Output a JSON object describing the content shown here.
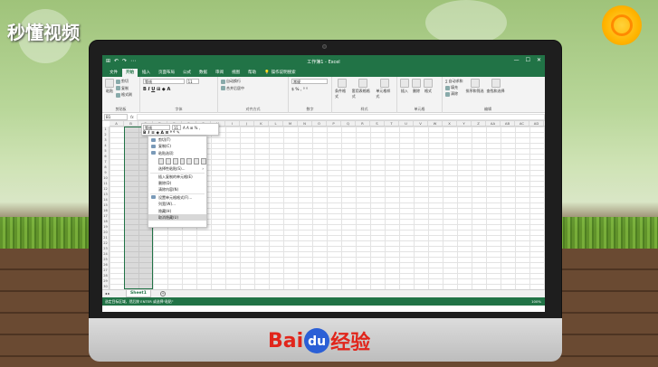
{
  "watermark": {
    "top_left": "秒懂视频",
    "bottom_brand_bai": "Bai",
    "bottom_brand_du": "du",
    "bottom_brand_jy": "经验"
  },
  "excel": {
    "title": "工作簿1 - Excel",
    "qat": [
      "⊞",
      "↶",
      "↷",
      "⋯"
    ],
    "window_controls": [
      "—",
      "☐",
      "✕"
    ],
    "tabs": [
      "文件",
      "开始",
      "插入",
      "页面布局",
      "公式",
      "数据",
      "审阅",
      "视图",
      "帮助"
    ],
    "active_tab": "开始",
    "tell_me": "操作说明搜索",
    "ribbon": {
      "clipboard": {
        "label": "剪贴板",
        "paste": "粘贴",
        "cut": "剪切",
        "copy": "复制",
        "format": "格式刷"
      },
      "font": {
        "label": "字体",
        "name": "等线",
        "size": "11"
      },
      "alignment": {
        "label": "对齐方式",
        "wrap": "自动换行",
        "merge": "合并后居中"
      },
      "number": {
        "label": "数字",
        "format": "常规"
      },
      "styles": {
        "label": "样式",
        "cond": "条件格式",
        "table": "套用表格格式",
        "cell": "单元格样式"
      },
      "cells": {
        "label": "单元格",
        "insert": "插入",
        "delete": "删除",
        "format": "格式"
      },
      "editing": {
        "label": "编辑",
        "autosum": "自动求和",
        "fill": "填充",
        "clear": "清除",
        "sort": "排序和筛选",
        "find": "查找和选择"
      }
    },
    "name_box": "B1",
    "formula_fx": "fx",
    "columns": [
      "A",
      "B",
      "C",
      "D",
      "E",
      "F",
      "G",
      "H",
      "I",
      "J",
      "K",
      "L",
      "M",
      "N",
      "O",
      "P",
      "Q",
      "R",
      "S",
      "T",
      "U",
      "V",
      "W",
      "X",
      "Y",
      "Z",
      "AA",
      "AB",
      "AC",
      "AD"
    ],
    "rows": [
      "1",
      "2",
      "3",
      "4",
      "5",
      "6",
      "7",
      "8",
      "9",
      "10",
      "11",
      "12",
      "13",
      "14",
      "15",
      "16",
      "17",
      "18",
      "19",
      "20",
      "21",
      "22",
      "23",
      "24",
      "25",
      "26",
      "27",
      "28",
      "29",
      "30",
      "31"
    ],
    "mini_toolbar": {
      "font": "等线",
      "size": "11"
    },
    "context_menu": {
      "items": [
        "剪切(T)",
        "复制(C)",
        "粘贴选项:",
        "选择性粘贴(S)...",
        "插入复制的单元格(E)",
        "删除(D)",
        "清除内容(N)",
        "设置单元格格式(F)...",
        "列宽(W)...",
        "隐藏(H)",
        "取消隐藏(U)"
      ],
      "highlighted": "取消隐藏(U)"
    },
    "sheet_tab": "Sheet1",
    "add_sheet": "+",
    "status_text": "选定目标区域，然后按 ENTER 或选择\"粘贴\"",
    "zoom": "100%"
  }
}
